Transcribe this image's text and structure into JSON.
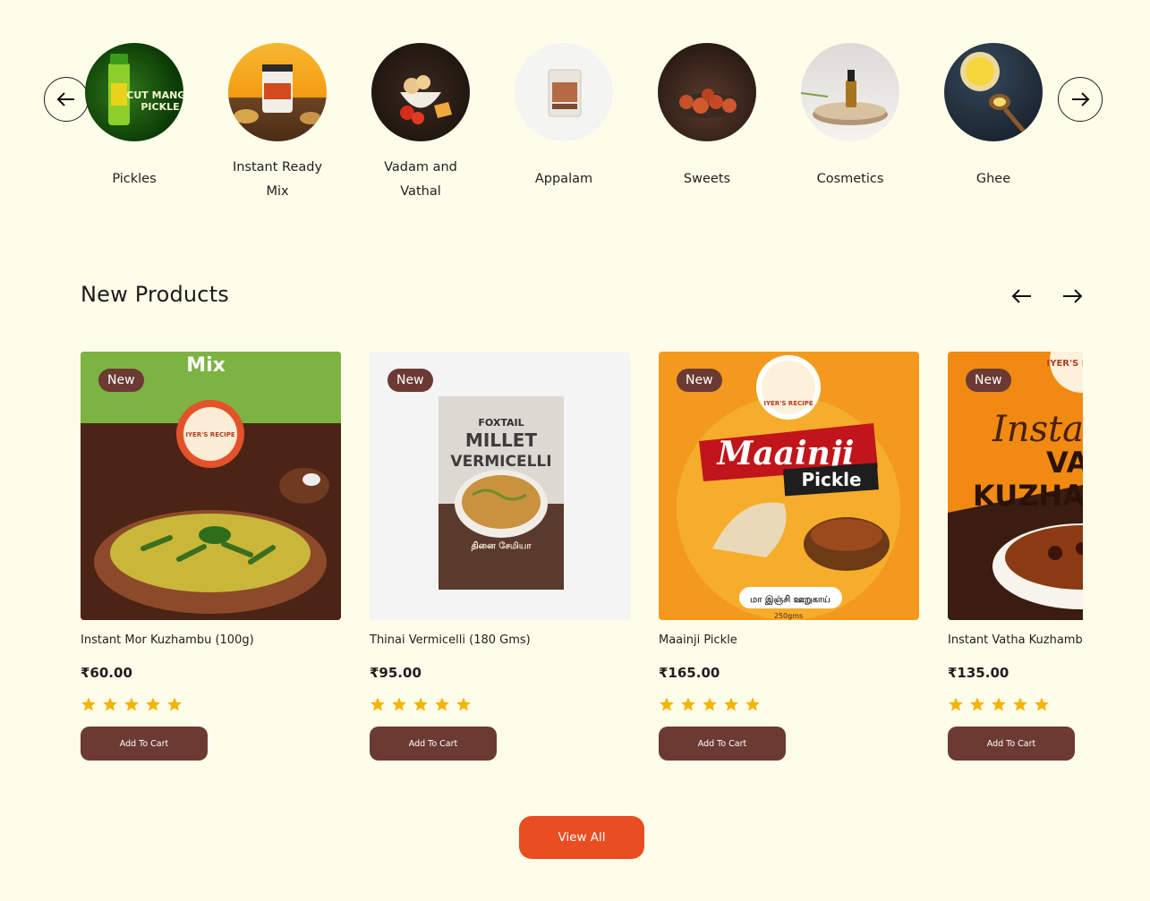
{
  "categories": [
    {
      "label": "Pickles",
      "image": "pickles-bottle-image"
    },
    {
      "label": "Instant Ready Mix",
      "image": "instant-mix-jar-image"
    },
    {
      "label": "Vadam and Vathal",
      "image": "vadam-bowl-image"
    },
    {
      "label": "Appalam",
      "image": "appalam-pack-image"
    },
    {
      "label": "Sweets",
      "image": "sweets-plate-image"
    },
    {
      "label": "Cosmetics",
      "image": "oil-bottle-image"
    },
    {
      "label": "Ghee",
      "image": "ghee-spoon-image"
    }
  ],
  "section": {
    "title": "New Products"
  },
  "products": [
    {
      "badge": "New",
      "name": "Instant Mor Kuzhambu (100g)",
      "price": "₹60.00",
      "rating": 5,
      "cart_label": "Add To Cart",
      "image_text": "Mix",
      "brand": "IYER'S RECIPE"
    },
    {
      "badge": "New",
      "name": "Thinai Vermicelli (180 Gms)",
      "price": "₹95.00",
      "rating": 5,
      "cart_label": "Add To Cart",
      "image_text": "FOXTAIL MILLET VERMICELLI",
      "sub_text": "தினை சேமியா"
    },
    {
      "badge": "New",
      "name": "Maainji Pickle",
      "price": "₹165.00",
      "rating": 5,
      "cart_label": "Add To Cart",
      "image_text": "Maainji",
      "sub_text": "Pickle",
      "tamil_text": "மா இஞ்சி ஊறுகாய்",
      "weight": "250gms",
      "brand": "IYER'S RECIPE"
    },
    {
      "badge": "New",
      "name": "Instant Vatha Kuzhambu",
      "price": "₹135.00",
      "rating": 5,
      "cart_label": "Add To Cart",
      "image_text": "Instant",
      "sub_text": "VATHA KUZHAMBU",
      "brand": "IYER'S RECIPE"
    }
  ],
  "view_all": "View All",
  "colors": {
    "background": "#fefdea",
    "brown": "#6a3a33",
    "orange": "#e94d22",
    "star": "#f4b400"
  }
}
